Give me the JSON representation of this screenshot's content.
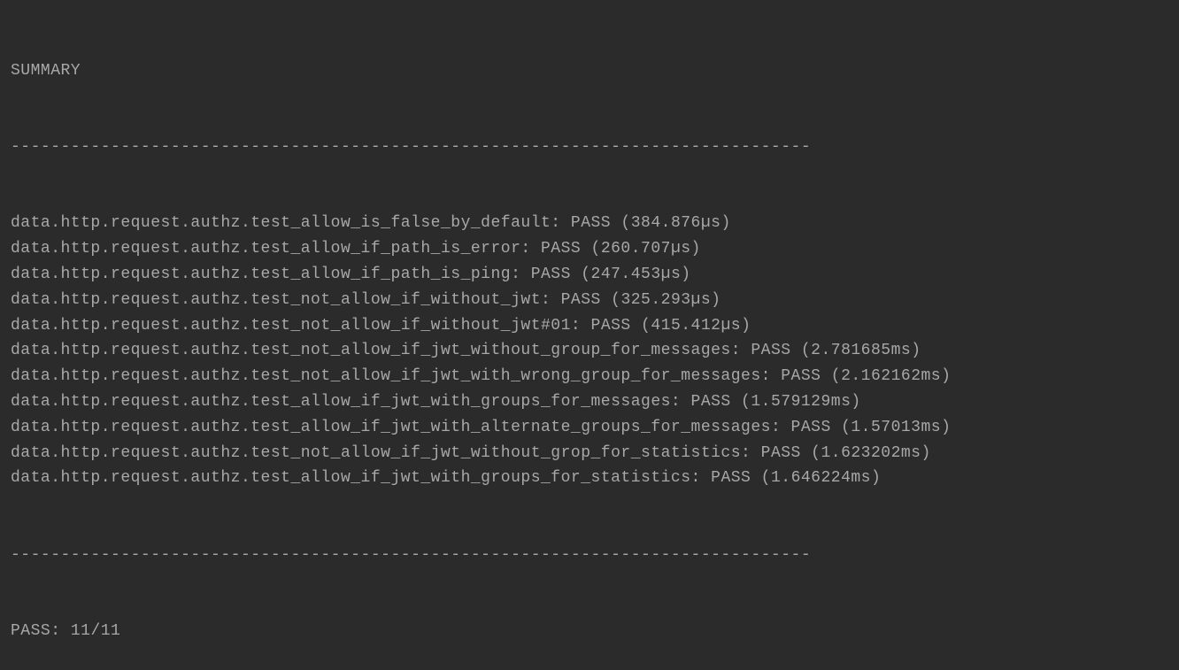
{
  "header": "SUMMARY",
  "divider": "--------------------------------------------------------------------------------",
  "tests": [
    {
      "name": "data.http.request.authz.test_allow_is_false_by_default",
      "status": "PASS",
      "duration": "384.876µs"
    },
    {
      "name": "data.http.request.authz.test_allow_if_path_is_error",
      "status": "PASS",
      "duration": "260.707µs"
    },
    {
      "name": "data.http.request.authz.test_allow_if_path_is_ping",
      "status": "PASS",
      "duration": "247.453µs"
    },
    {
      "name": "data.http.request.authz.test_not_allow_if_without_jwt",
      "status": "PASS",
      "duration": "325.293µs"
    },
    {
      "name": "data.http.request.authz.test_not_allow_if_without_jwt#01",
      "status": "PASS",
      "duration": "415.412µs"
    },
    {
      "name": "data.http.request.authz.test_not_allow_if_jwt_without_group_for_messages",
      "status": "PASS",
      "duration": "2.781685ms"
    },
    {
      "name": "data.http.request.authz.test_not_allow_if_jwt_with_wrong_group_for_messages",
      "status": "PASS",
      "duration": "2.162162ms"
    },
    {
      "name": "data.http.request.authz.test_allow_if_jwt_with_groups_for_messages",
      "status": "PASS",
      "duration": "1.579129ms"
    },
    {
      "name": "data.http.request.authz.test_allow_if_jwt_with_alternate_groups_for_messages",
      "status": "PASS",
      "duration": "1.57013ms"
    },
    {
      "name": "data.http.request.authz.test_not_allow_if_jwt_without_grop_for_statistics",
      "status": "PASS",
      "duration": "1.623202ms"
    },
    {
      "name": "data.http.request.authz.test_allow_if_jwt_with_groups_for_statistics",
      "status": "PASS",
      "duration": "1.646224ms"
    }
  ],
  "summary": {
    "label": "PASS",
    "passed": 11,
    "total": 11
  }
}
